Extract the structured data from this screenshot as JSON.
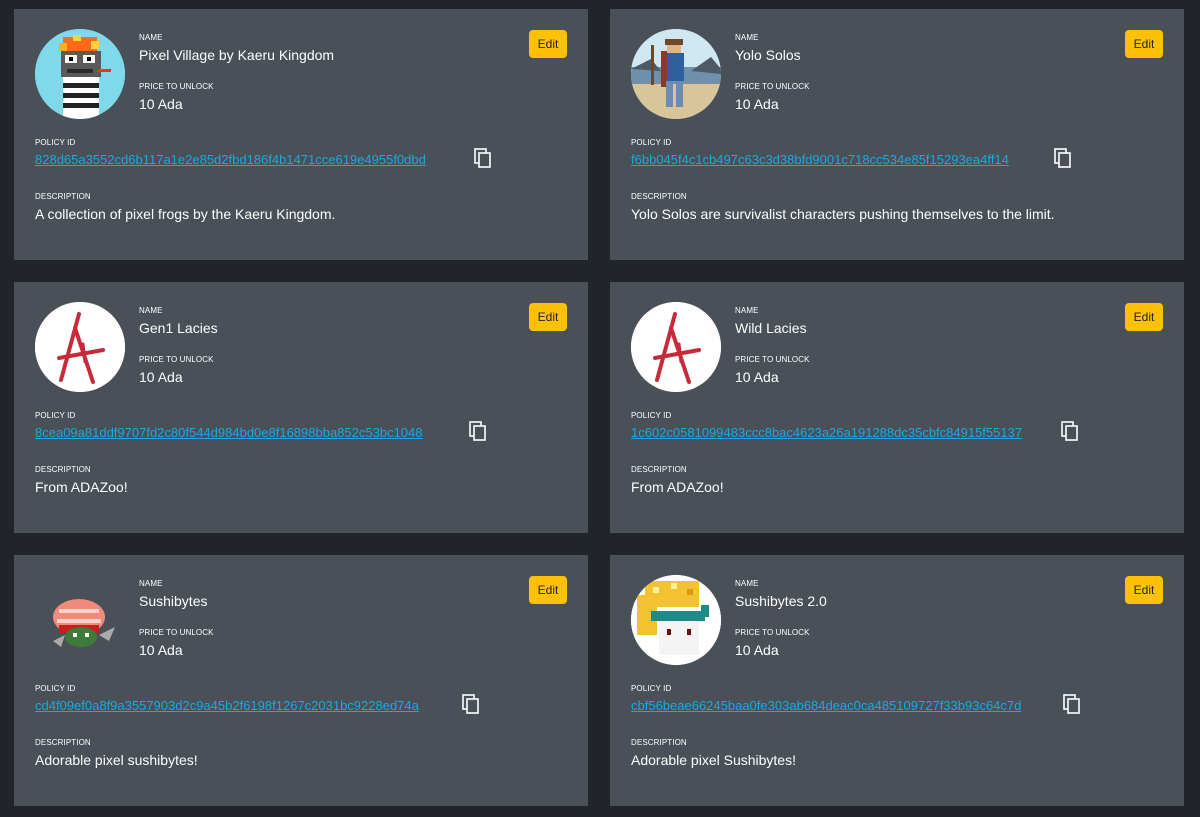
{
  "labels": {
    "name": "NAME",
    "price": "PRICE TO UNLOCK",
    "policy": "POLICY ID",
    "description": "DESCRIPTION",
    "edit": "Edit"
  },
  "colors": {
    "page_bg": "#212529",
    "card_bg": "#495057",
    "edit_button": "#ffc107",
    "link": "#1ba9e0"
  },
  "cards": [
    {
      "avatar_icon": "pixel-frog-avatar-icon",
      "name": "Pixel Village by Kaeru Kingdom",
      "price": "10 Ada",
      "policy_id": "828d65a3552cd6b117a1e2e85d2fbd186f4b1471cce619e4955f0dbd",
      "description": "A collection of pixel frogs by the Kaeru Kingdom."
    },
    {
      "avatar_icon": "survivalist-character-avatar-icon",
      "name": "Yolo Solos",
      "price": "10 Ada",
      "policy_id": "f6bb045f4c1cb497c63c3d38bfd9001c718cc534e85f15293ea4ff14",
      "description": "Yolo Solos are survivalist characters pushing themselves to the limit."
    },
    {
      "avatar_icon": "adazoo-logo-icon",
      "name": "Gen1 Lacies",
      "price": "10 Ada",
      "policy_id": "8cea09a81ddf9707fd2c80f544d984bd0e8f16898bba852c53bc1048",
      "description": "From ADAZoo!"
    },
    {
      "avatar_icon": "adazoo-logo-icon",
      "name": "Wild Lacies",
      "price": "10 Ada",
      "policy_id": "1c602c0581099483ccc8bac4623a26a191288dc35cbfc84915f55137",
      "description": "From ADAZoo!"
    },
    {
      "avatar_icon": "sushi-character-avatar-icon",
      "name": "Sushibytes",
      "price": "10 Ada",
      "policy_id": "cd4f09ef0a8f9a3557903d2c9a45b2f6198f1267c2031bc9228ed74a",
      "description": "Adorable pixel sushibytes!"
    },
    {
      "avatar_icon": "sushi-character-avatar-icon",
      "name": "Sushibytes 2.0",
      "price": "10 Ada",
      "policy_id": "cbf56beae66245baa0fe303ab684deac0ca485109727f33b93c64c7d",
      "description": "Adorable pixel Sushibytes!"
    }
  ]
}
